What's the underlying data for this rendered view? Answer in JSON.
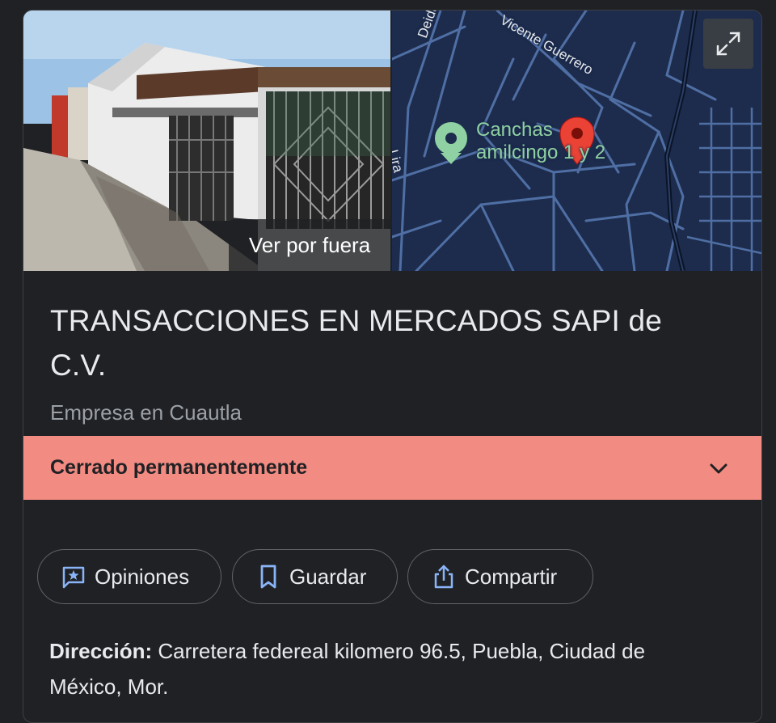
{
  "streetview": {
    "label": "Ver por fuera"
  },
  "map": {
    "place_label_line1": "Canchas",
    "place_label_line2": "amilcingo 1 y 2",
    "street_1": "Deidades",
    "street_2": "Vicente Guerrero",
    "street_3": "Lira",
    "colors": {
      "background": "#1d2c4d",
      "roads": "#4f6fa4",
      "pin": "#ea4335",
      "place_marker": "#8fd1a2"
    }
  },
  "business": {
    "name": "TRANSACCIONES EN MERCADOS SAPI de C.V.",
    "category": "Empresa en Cuautla",
    "status": "Cerrado permanentemente",
    "status_color": "#f28b82"
  },
  "actions": [
    {
      "label": "Opiniones",
      "icon": "review-star-icon"
    },
    {
      "label": "Guardar",
      "icon": "bookmark-icon"
    },
    {
      "label": "Compartir",
      "icon": "share-icon"
    }
  ],
  "address": {
    "label": "Dirección:",
    "value": " Carretera federeal kilomero 96.5, Puebla, Ciudad de México, Mor."
  }
}
